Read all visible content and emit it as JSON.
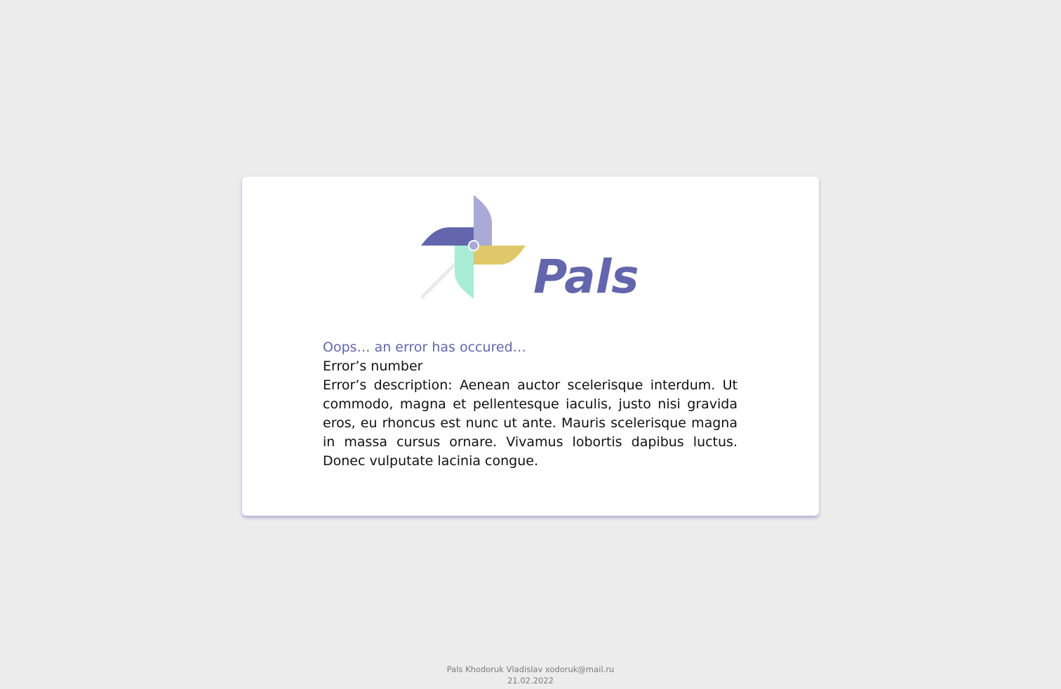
{
  "brand": {
    "name": "Pals",
    "logo_icon": "pinwheel-icon",
    "colors": {
      "primary": "#6366ac",
      "lavender": "#a9aad5",
      "yellow": "#dfc869",
      "mint": "#a8ecd6",
      "stick": "#e6e6e6"
    }
  },
  "error": {
    "title": "Oops… an error has occured…",
    "number_label": "Error’s number",
    "description": "Error’s description: Aenean auctor scelerisque interdum. Ut commodo, magna et pellentesque iaculis, justo nisi gravida eros, eu rhoncus est nunc ut ante. Mauris scelerisque magna in massa cursus ornare. Vivamus lobortis dapibus luctus. Donec vulputate lacinia congue."
  },
  "footer": {
    "credits": "Pals Khodoruk Vladislav xodoruk@mail.ru",
    "date": "21.02.2022"
  }
}
